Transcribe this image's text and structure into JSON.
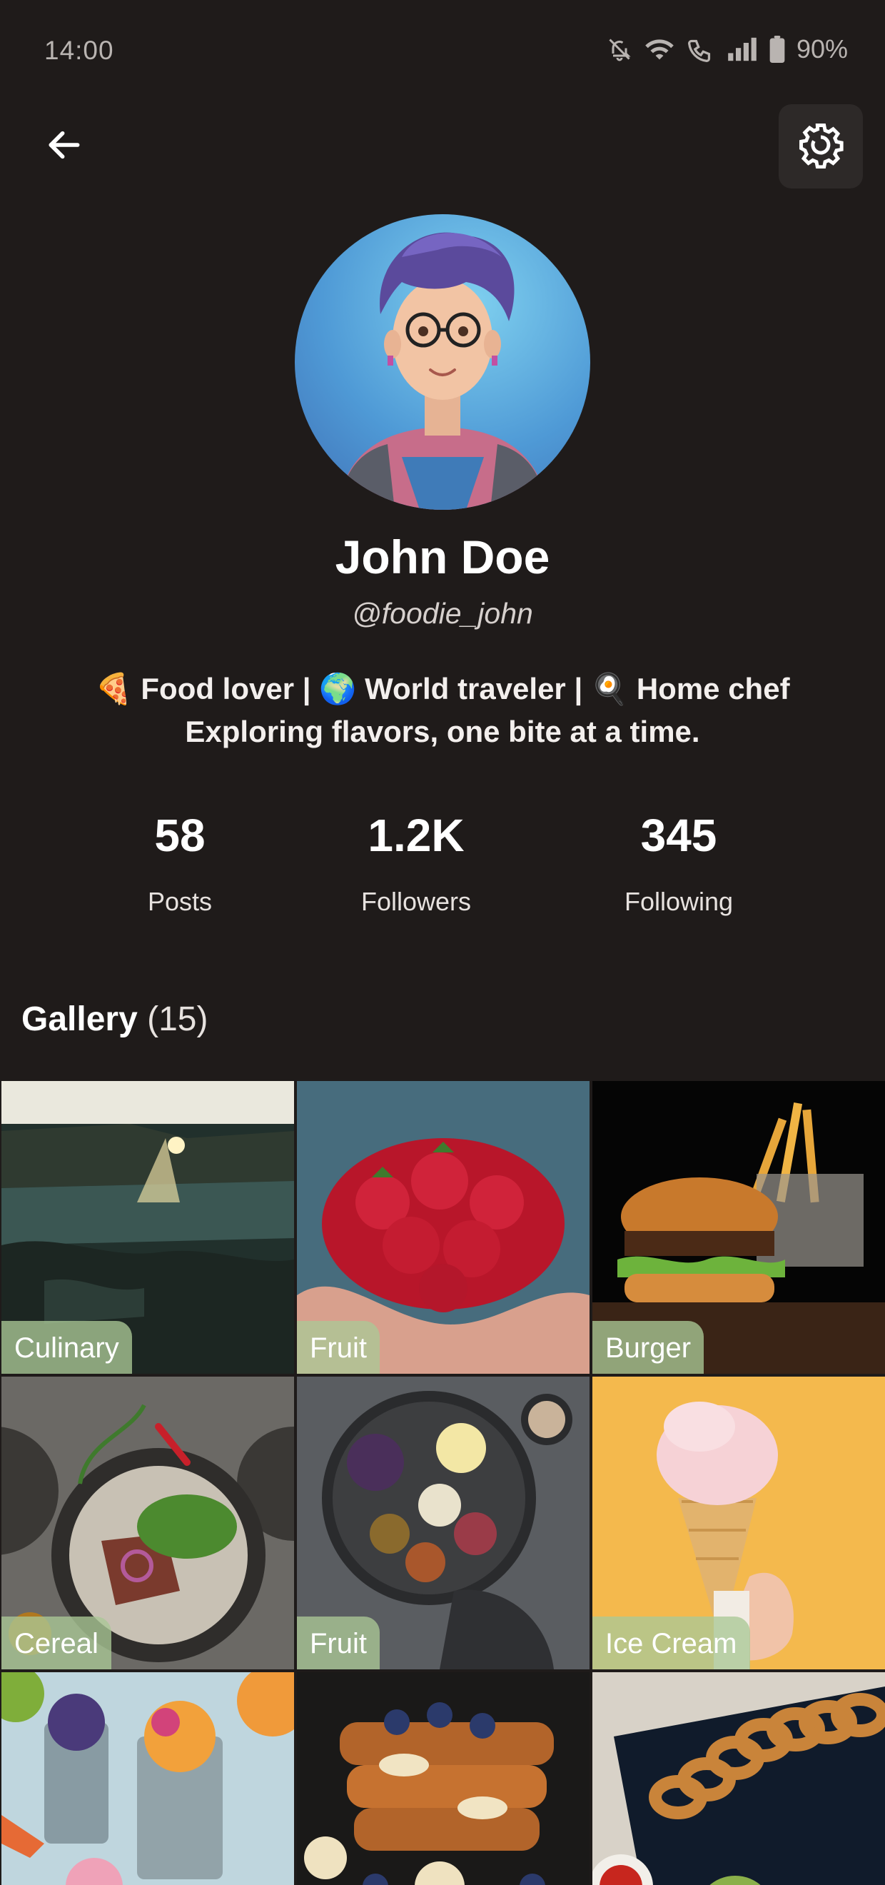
{
  "status_bar": {
    "time": "14:00",
    "battery": "90%"
  },
  "profile": {
    "name": "John Doe",
    "handle": "@foodie_john",
    "bio_line1": {
      "emoji1": "🍕",
      "text1": "Food lover | ",
      "emoji2": "🌍",
      "text2": "World traveler | ",
      "emoji3": "🍳",
      "text3": "Home chef"
    },
    "bio_line2": "Exploring flavors, one bite at a time."
  },
  "stats": [
    {
      "value": "58",
      "label": "Posts"
    },
    {
      "value": "1.2K",
      "label": "Followers"
    },
    {
      "value": "345",
      "label": "Following"
    }
  ],
  "gallery": {
    "title": "Gallery",
    "count": "(15)",
    "items": [
      {
        "label": "Culinary",
        "image": "coastal-rocks-sunset"
      },
      {
        "label": "Fruit",
        "image": "strawberries-in-hands"
      },
      {
        "label": "Burger",
        "image": "burger-and-fries"
      },
      {
        "label": "Cereal",
        "image": "steak-salad-plate"
      },
      {
        "label": "Fruit",
        "image": "cheese-fruit-platter"
      },
      {
        "label": "Ice Cream",
        "image": "ice-cream-cone"
      },
      {
        "label": "",
        "image": "fruit-smoothies"
      },
      {
        "label": "",
        "image": "french-toast-berries"
      },
      {
        "label": "",
        "image": "onion-rings"
      }
    ]
  },
  "colors": {
    "background": "#1f1b1a",
    "settings_button_bg": "#2d2928",
    "tile_label_bg": "#aac896"
  },
  "icons": {
    "back": "arrow-left-icon",
    "settings": "gear-icon",
    "wifi": "wifi-icon",
    "call": "wifi-call-icon",
    "signal": "signal-icon",
    "battery": "battery-icon",
    "mute": "bell-off-icon"
  }
}
